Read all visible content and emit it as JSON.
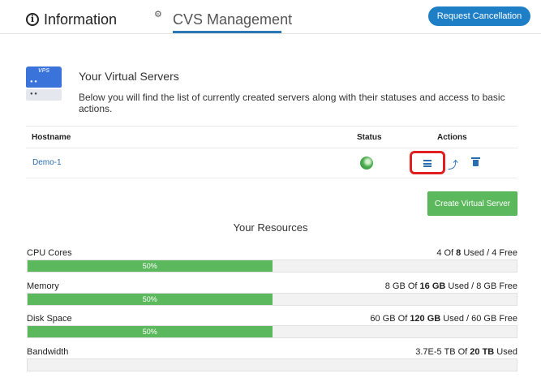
{
  "tabs": {
    "information": "Information",
    "cvs_management": "CVS Management"
  },
  "request_cancellation": "Request Cancellation",
  "vps_icon_label": "VPS",
  "virtual_servers": {
    "title": "Your Virtual Servers",
    "description": "Below you will find the list of currently created servers along with their statuses and access to basic actions."
  },
  "table": {
    "headers": {
      "hostname": "Hostname",
      "status": "Status",
      "actions": "Actions"
    },
    "rows": [
      {
        "hostname": "Demo-1",
        "status": "online",
        "actions": [
          "manage-icon",
          "migrate-icon",
          "trash-icon"
        ]
      }
    ]
  },
  "create_button": "Create Virtual Server",
  "resources": {
    "title": "Your Resources",
    "items": [
      {
        "label": "CPU Cores",
        "used": "4",
        "total": "8",
        "mid": " Of ",
        "suffix": " Used / 4 Free",
        "percent": 50,
        "percent_label": "50%"
      },
      {
        "label": "Memory",
        "used": "8 GB",
        "total": "16 GB",
        "mid": " Of ",
        "suffix": " Used / 8 GB Free",
        "percent": 50,
        "percent_label": "50%"
      },
      {
        "label": "Disk Space",
        "used": "60 GB",
        "total": "120 GB",
        "mid": " Of ",
        "suffix": " Used / 60 GB Free",
        "percent": 50,
        "percent_label": "50%"
      },
      {
        "label": "Bandwidth",
        "used": "3.7E-5 TB",
        "total": "20 TB",
        "mid": " Of ",
        "suffix": " Used",
        "percent": 0,
        "percent_label": ""
      }
    ]
  },
  "colors": {
    "accent": "#1e7fc6",
    "link": "#2a6eb0",
    "success": "#5cb85c",
    "highlight": "#e02020"
  }
}
